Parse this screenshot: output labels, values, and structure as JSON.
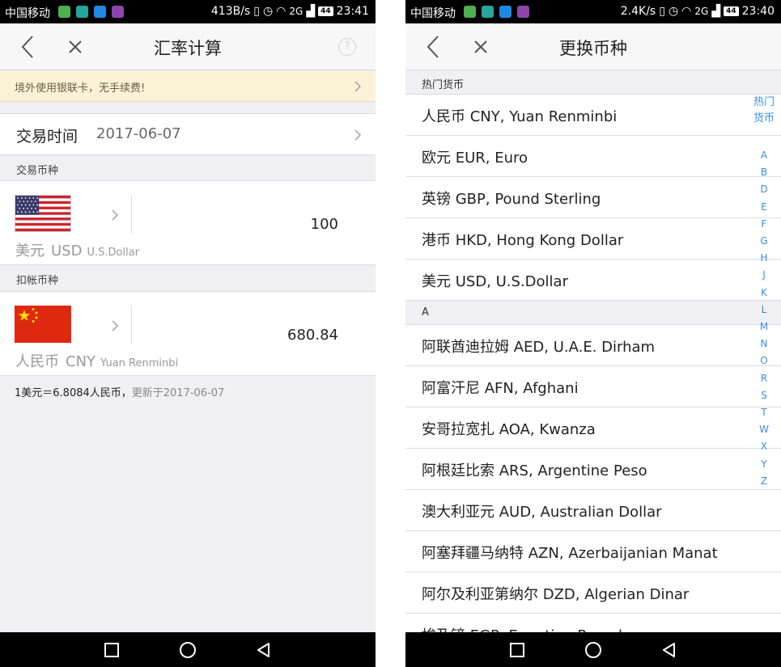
{
  "left": {
    "status": {
      "carrier": "中国移动",
      "net_speed": "413B/s",
      "network": "2G",
      "battery": "44",
      "time": "23:41"
    },
    "title": "汇率计算",
    "banner": "境外使用银联卡，无手续费!",
    "trade_time_label": "交易时间",
    "trade_date": "2017-06-07",
    "trade_currency_section": "交易币种",
    "from": {
      "cn": "美元",
      "code": "USD",
      "en": "U.S.Dollar",
      "amount": "100"
    },
    "debit_currency_section": "扣帐币种",
    "to": {
      "cn": "人民币",
      "code": "CNY",
      "en": "Yuan Renminbi",
      "amount": "680.84"
    },
    "rate_text": "1美元＝6.8084人民币，",
    "updated_text": "更新于2017-06-07",
    "help_icon": "?"
  },
  "right": {
    "status": {
      "carrier": "中国移动",
      "net_speed": "2.4K/s",
      "network": "2G",
      "battery": "44",
      "time": "23:40"
    },
    "title": "更换币种",
    "hot_section": "热门货币",
    "hot_currencies": [
      "人民币  CNY,  Yuan Renminbi",
      "欧元  EUR,  Euro",
      "英镑  GBP,  Pound Sterling",
      "港币  HKD,  Hong Kong Dollar",
      "美元  USD,  U.S.Dollar"
    ],
    "section_a": "A",
    "a_currencies": [
      "阿联酋迪拉姆  AED,  U.A.E. Dirham",
      "阿富汗尼  AFN,  Afghani",
      "安哥拉宽扎  AOA,  Kwanza",
      "阿根廷比索  ARS,  Argentine Peso",
      "澳大利亚元  AUD,  Australian Dollar",
      "阿塞拜疆马纳特  AZN,  Azerbaijanian Manat",
      "阿尔及利亚第纳尔  DZD,  Algerian Dinar",
      "埃及镑  EGP,  Egyptian Pound"
    ],
    "index_hot": "热门\n货币",
    "index_hot_line1": "热门",
    "index_hot_line2": "货币",
    "index_letters": [
      "A",
      "B",
      "D",
      "E",
      "F",
      "G",
      "H",
      "J",
      "K",
      "L",
      "M",
      "N",
      "O",
      "R",
      "S",
      "T",
      "W",
      "X",
      "Y",
      "Z"
    ]
  },
  "colors": {
    "accent": "#3a8ee6",
    "banner_bg": "#fbf1d7",
    "page_bg": "#efeff4"
  },
  "icons": [
    "back-chevron-icon",
    "close-x-icon",
    "help-circle-icon",
    "chevron-right-icon",
    "us-flag-icon",
    "china-flag-icon",
    "square-recents-icon",
    "circle-home-icon",
    "triangle-back-icon"
  ]
}
